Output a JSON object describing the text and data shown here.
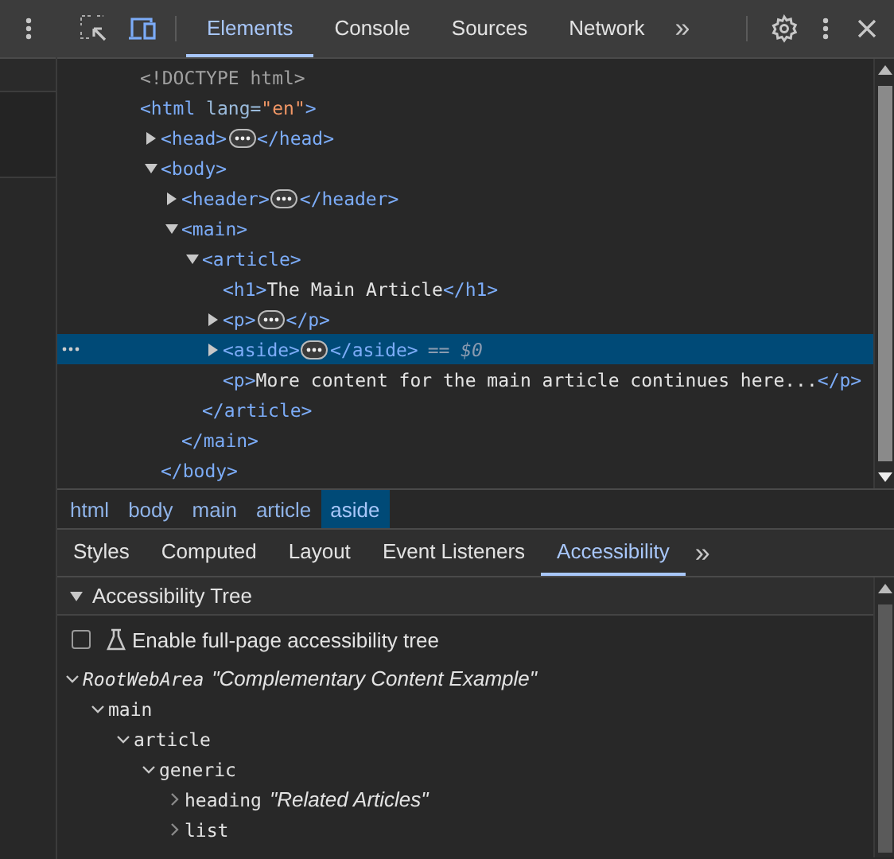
{
  "toolbar": {
    "tabs": [
      {
        "label": "Elements",
        "selected": true
      },
      {
        "label": "Console",
        "selected": false
      },
      {
        "label": "Sources",
        "selected": false
      },
      {
        "label": "Network",
        "selected": false
      }
    ],
    "more": "»"
  },
  "dom_tree": [
    {
      "kind": "doctype",
      "open": "<!DOCTYPE html>",
      "selected": false
    },
    {
      "kind": "element",
      "open": "<html",
      "attrs": [
        {
          "name": " lang=",
          "value": "\"en\""
        }
      ],
      "open_end": ">",
      "selected": false,
      "children": [
        {
          "kind": "element",
          "open": "<head>",
          "close": "</head>",
          "expanded": false,
          "selected": false
        },
        {
          "kind": "element",
          "open": "<body>",
          "close": "</body>",
          "expanded": true,
          "selected": false,
          "children": [
            {
              "kind": "element",
              "open": "<header>",
              "close": "</header>",
              "expanded": false,
              "selected": false
            },
            {
              "kind": "element",
              "open": "<main>",
              "close": "</main>",
              "expanded": true,
              "selected": false,
              "children": [
                {
                  "kind": "element",
                  "open": "<article>",
                  "close": "</article>",
                  "expanded": true,
                  "selected": false,
                  "children": [
                    {
                      "kind": "leaf",
                      "open": "<h1>",
                      "text": "The Main Article",
                      "close": "</h1>",
                      "selected": false
                    },
                    {
                      "kind": "element",
                      "open": "<p>",
                      "close": "</p>",
                      "expanded": false,
                      "selected": false
                    },
                    {
                      "kind": "element",
                      "open": "<aside>",
                      "close": "</aside>",
                      "expanded": false,
                      "selected": true,
                      "suffix": "== $0"
                    },
                    {
                      "kind": "leaf",
                      "open": "<p>",
                      "text": "More content for the main article continues here...",
                      "close": "</p>",
                      "selected": false
                    }
                  ]
                }
              ]
            }
          ]
        }
      ]
    }
  ],
  "breadcrumbs": [
    {
      "label": "html",
      "selected": false
    },
    {
      "label": "body",
      "selected": false
    },
    {
      "label": "main",
      "selected": false
    },
    {
      "label": "article",
      "selected": false
    },
    {
      "label": "aside",
      "selected": true
    }
  ],
  "sub_tabs": {
    "tabs": [
      {
        "label": "Styles",
        "selected": false
      },
      {
        "label": "Computed",
        "selected": false
      },
      {
        "label": "Layout",
        "selected": false
      },
      {
        "label": "Event Listeners",
        "selected": false
      },
      {
        "label": "Accessibility",
        "selected": true
      }
    ],
    "more": "»"
  },
  "accessibility": {
    "section_title": "Accessibility Tree",
    "section_expanded": true,
    "full_page_option": {
      "label": "Enable full-page accessibility tree",
      "checked": false
    },
    "tree": [
      {
        "role": "RootWebArea",
        "name": "\"Complementary Content Example\"",
        "expanded": true,
        "children": [
          {
            "role": "main",
            "expanded": true,
            "children": [
              {
                "role": "article",
                "expanded": true,
                "children": [
                  {
                    "role": "generic",
                    "expanded": true,
                    "children": [
                      {
                        "role": "heading",
                        "name": "\"Related Articles\"",
                        "expanded": false
                      },
                      {
                        "role": "list",
                        "expanded": false
                      }
                    ]
                  }
                ]
              }
            ]
          }
        ]
      }
    ]
  }
}
